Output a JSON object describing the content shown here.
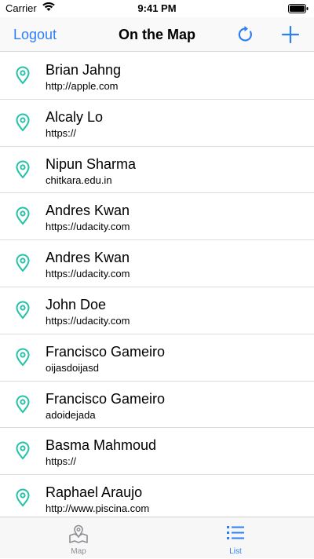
{
  "status_bar": {
    "carrier": "Carrier",
    "time": "9:41 PM"
  },
  "nav": {
    "logout": "Logout",
    "title": "On the Map",
    "refresh_icon": "refresh-icon",
    "add_icon": "plus-icon"
  },
  "colors": {
    "accent": "#2f7ff4",
    "pin": "#26c1a8",
    "inactive": "#8e8e93"
  },
  "list": {
    "items": [
      {
        "name": "Brian Jahng",
        "url": "http://apple.com"
      },
      {
        "name": "Alcaly Lo",
        "url": "https://"
      },
      {
        "name": "Nipun Sharma",
        "url": "chitkara.edu.in"
      },
      {
        "name": "Andres Kwan",
        "url": "https://udacity.com"
      },
      {
        "name": "Andres Kwan",
        "url": "https://udacity.com"
      },
      {
        "name": "John Doe",
        "url": "https://udacity.com"
      },
      {
        "name": "Francisco Gameiro",
        "url": "oijasdoijasd"
      },
      {
        "name": "Francisco Gameiro",
        "url": "adoidejada"
      },
      {
        "name": "Basma Mahmoud",
        "url": "https://"
      },
      {
        "name": "Raphael Araujo",
        "url": "http://www.piscina.com"
      }
    ]
  },
  "tabs": [
    {
      "label": "Map",
      "icon": "map-icon",
      "selected": false
    },
    {
      "label": "List",
      "icon": "list-icon",
      "selected": true
    }
  ]
}
